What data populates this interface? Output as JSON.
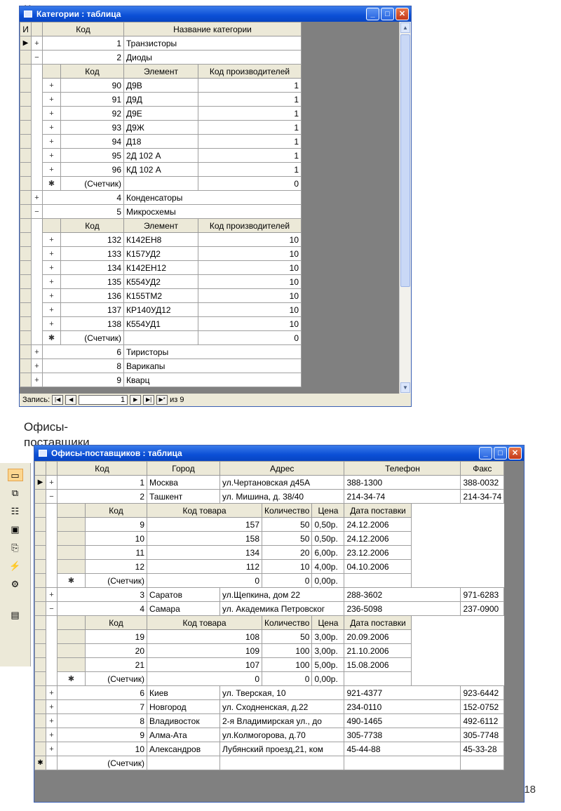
{
  "slide": {
    "label1": "Категории",
    "label2": "Офисы-\nпоставщики",
    "page_number": "18"
  },
  "win1": {
    "title": "Категории : таблица",
    "header": [
      "Код",
      "Название категории"
    ],
    "sub_header": [
      "Код",
      "Элемент",
      "Код производителей"
    ],
    "counter_label": "(Счетчик)",
    "rows": [
      {
        "exp": "+",
        "code": "1",
        "name": "Транзисторы",
        "current": true
      },
      {
        "exp": "−",
        "code": "2",
        "name": "Диоды",
        "children": [
          [
            "90",
            "Д9В",
            "1"
          ],
          [
            "91",
            "Д9Д",
            "1"
          ],
          [
            "92",
            "Д9Е",
            "1"
          ],
          [
            "93",
            "Д9Ж",
            "1"
          ],
          [
            "94",
            "Д18",
            "1"
          ],
          [
            "95",
            "2Д 102 А",
            "1"
          ],
          [
            "96",
            "КД 102 А",
            "1"
          ]
        ],
        "new_value": "0"
      },
      {
        "exp": "+",
        "code": "4",
        "name": "Конденсаторы"
      },
      {
        "exp": "−",
        "code": "5",
        "name": "Микросхемы",
        "children": [
          [
            "132",
            "К142ЕН8",
            "10"
          ],
          [
            "133",
            "К157УД2",
            "10"
          ],
          [
            "134",
            "К142ЕН12",
            "10"
          ],
          [
            "135",
            "К554УД2",
            "10"
          ],
          [
            "136",
            "К155ТМ2",
            "10"
          ],
          [
            "137",
            "КР140УД12",
            "10"
          ],
          [
            "138",
            "К554УД1",
            "10"
          ]
        ],
        "new_value": "0"
      },
      {
        "exp": "+",
        "code": "6",
        "name": "Тиристоры"
      },
      {
        "exp": "+",
        "code": "8",
        "name": "Варикапы"
      },
      {
        "exp": "+",
        "code": "9",
        "name": "Кварц"
      }
    ],
    "nav_label": "Запись:",
    "nav_current": "1",
    "nav_of": "из 9"
  },
  "win2": {
    "title": "Офисы-поставщиков : таблица",
    "header": [
      "Код",
      "Город",
      "Адрес",
      "Телефон",
      "Факс"
    ],
    "sub_header": [
      "Код",
      "Код товара",
      "Количество",
      "Цена",
      "Дата поставки"
    ],
    "counter_label": "(Счетчик)",
    "rows": [
      {
        "exp": "+",
        "code": "1",
        "city": "Москва",
        "addr": "ул.Чертановская д45А",
        "tel": "388-1300",
        "fax": "388-0032",
        "current": true
      },
      {
        "exp": "−",
        "code": "2",
        "city": "Ташкент",
        "addr": "ул. Мишина, д. 38/40",
        "tel": "214-34-74",
        "fax": "214-34-74",
        "children": [
          [
            "9",
            "157",
            "50",
            "0,50р.",
            "24.12.2006"
          ],
          [
            "10",
            "158",
            "50",
            "0,50р.",
            "24.12.2006"
          ],
          [
            "11",
            "134",
            "20",
            "6,00р.",
            "23.12.2006"
          ],
          [
            "12",
            "112",
            "10",
            "4,00р.",
            "04.10.2006"
          ]
        ],
        "new_row": [
          "0",
          "0",
          "0,00р."
        ]
      },
      {
        "exp": "+",
        "code": "3",
        "city": "Саратов",
        "addr": "ул.Щепкина, дом 22",
        "tel": "288-3602",
        "fax": "971-6283"
      },
      {
        "exp": "−",
        "code": "4",
        "city": "Самара",
        "addr": "ул. Академика Петровског",
        "tel": "236-5098",
        "fax": "237-0900",
        "children": [
          [
            "19",
            "108",
            "50",
            "3,00р.",
            "20.09.2006"
          ],
          [
            "20",
            "109",
            "100",
            "3,00р.",
            "21.10.2006"
          ],
          [
            "21",
            "107",
            "100",
            "5,00р.",
            "15.08.2006"
          ]
        ],
        "new_row": [
          "0",
          "0",
          "0,00р."
        ]
      },
      {
        "exp": "+",
        "code": "6",
        "city": "Киев",
        "addr": "ул. Тверская, 10",
        "tel": "921-4377",
        "fax": "923-6442"
      },
      {
        "exp": "+",
        "code": "7",
        "city": "Новгород",
        "addr": "ул. Сходненская, д.22",
        "tel": "234-0110",
        "fax": "152-0752"
      },
      {
        "exp": "+",
        "code": "8",
        "city": "Владивосток",
        "addr": "2-я Владимирская ул., до",
        "tel": "490-1465",
        "fax": "492-6112"
      },
      {
        "exp": "+",
        "code": "9",
        "city": "Алма-Ата",
        "addr": "ул.Колмогорова, д.70",
        "tel": "305-7738",
        "fax": "305-7748"
      },
      {
        "exp": "+",
        "code": "10",
        "city": "Александров",
        "addr": "Лубянский проезд,21, ком",
        "tel": "45-44-88",
        "fax": "45-33-28"
      }
    ]
  }
}
